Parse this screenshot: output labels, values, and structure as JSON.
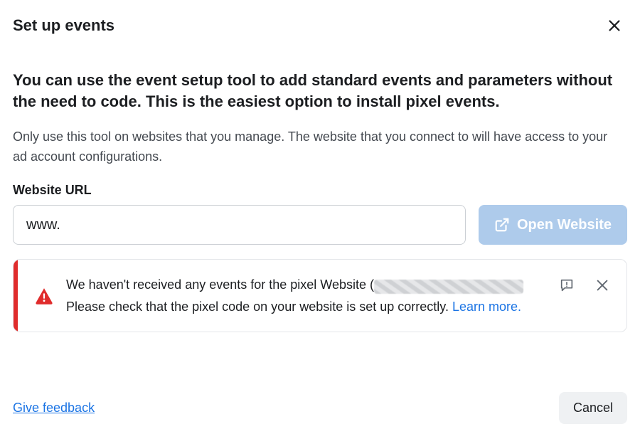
{
  "header": {
    "title": "Set up events"
  },
  "main": {
    "heading": "You can use the event setup tool to add standard events and parameters without the need to code. This is the easiest option to install pixel events.",
    "subtext": "Only use this tool on websites that you manage. The website that you connect to will have access to your ad account configurations.",
    "url_field": {
      "label": "Website URL",
      "value": "www.",
      "open_button": "Open Website"
    },
    "alert": {
      "text_pre": "We haven't received any events for the pixel Website (",
      "text_post": " Please check that the pixel code on your website is set up correctly. ",
      "learn_more": "Learn more."
    }
  },
  "footer": {
    "feedback": "Give feedback",
    "cancel": "Cancel"
  }
}
